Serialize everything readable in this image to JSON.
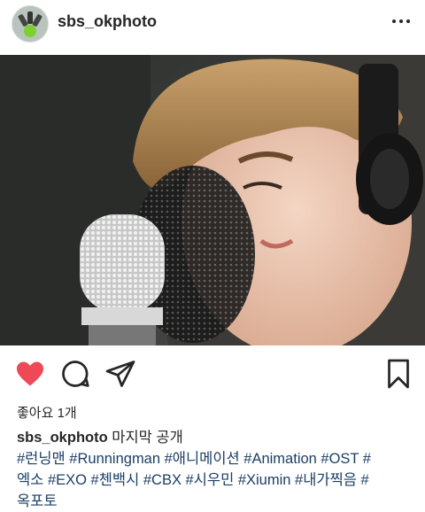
{
  "post": {
    "username": "sbs_okphoto",
    "likes_text": "좋아요 1개",
    "caption_user": "sbs_okphoto",
    "caption_text": "마지막 공개",
    "hashtags_line1": "#런닝맨 #Runningman #애니메이션 #Animation #OST #",
    "hashtags_line2": "엑소 #EXO #첸백시 #CBX #시우민 #Xiumin #내가찍음 #",
    "hashtags_line3": "옥포토"
  },
  "icons": {
    "avatar": "profile-avatar",
    "more": "more-options-icon",
    "like": "heart-icon",
    "comment": "comment-icon",
    "share": "share-icon",
    "save": "bookmark-icon"
  },
  "colors": {
    "like": "#ed4956",
    "hashtag": "#1c3f66",
    "text": "#262626"
  }
}
